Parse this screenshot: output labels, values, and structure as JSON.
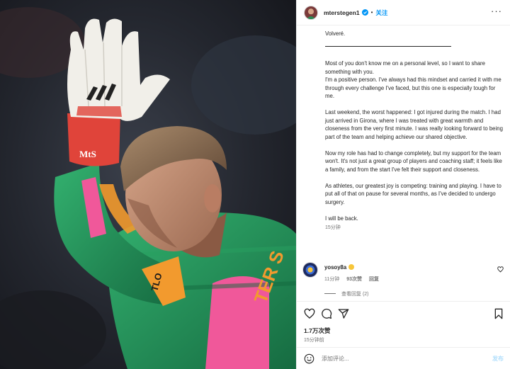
{
  "header": {
    "username": "mterstegen1",
    "separator": "•",
    "follow_label": "关注",
    "more_label": "···"
  },
  "caption": {
    "title": "Volveré.",
    "paragraphs": [
      "Most of you don't know me on a personal level, so I want to share something with you.\nI'm a positive person. I've always had this mindset and carried it with me through every challenge I've faced, but this one is especially tough for me.",
      "Last weekend, the worst happened: I got injured during the match. I had just arrived in Girona, where I was treated with great warmth and closeness from the very first minute. I was really looking forward to being part of the team and helping achieve our shared objective.",
      "Now my role has had to change completely, but my support for the team won't. It's not just a great group of players and coaching staff; it feels like a family, and from the start I've felt their support and closeness.",
      "As athletes, our greatest joy is competing: training and playing. I have to put all of that on pause for several months, as I've decided to undergo surgery.",
      "I will be back."
    ],
    "time": "15分钟"
  },
  "comment": {
    "username": "yosoy8a",
    "time": "11分钟",
    "likes": "93次赞",
    "reply_label": "回复",
    "view_replies": "查看回复 (2)"
  },
  "post": {
    "likes": "1.7万次赞",
    "time": "15分钟前"
  },
  "comment_box": {
    "placeholder": "添加评论...",
    "publish_label": "发布"
  },
  "photo": {
    "glove_text": "MtS",
    "sleeve_text": "TLO",
    "shirt_text": "TER S"
  },
  "colors": {
    "accent": "#0095f6",
    "jersey_green": "#1f8f57",
    "jersey_pink": "#f0589a",
    "jersey_orange": "#f29a2e",
    "glove_red": "#e0443a"
  }
}
